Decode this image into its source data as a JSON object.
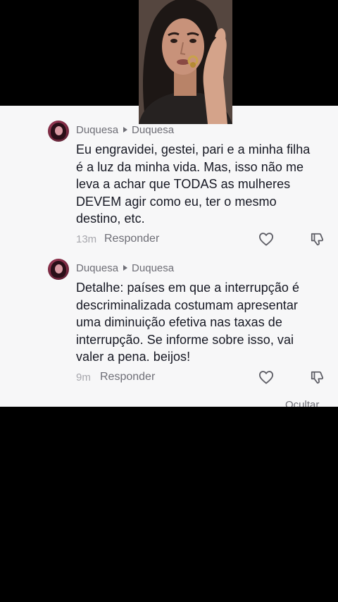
{
  "comments": [
    {
      "author": "Duquesa",
      "reply_to": "Duquesa",
      "text": "Eu engravidei, gestei, pari e a minha filha\né a luz da minha vida. Mas, isso não me\nleva a achar que TODAS as mulheres\nDEVEM agir como eu, ter o mesmo\ndestino, etc.",
      "time": "13m",
      "reply_label": "Responder"
    },
    {
      "author": "Duquesa",
      "reply_to": "Duquesa",
      "text": "Detalhe: países em que a interrupção é\ndescriminalizada costumam apresentar\numa diminuição efetiva nas taxas de\ninterrupção. Se informe sobre isso, vai\nvaler a pena. beijos!",
      "time": "9m",
      "reply_label": "Responder"
    }
  ],
  "hide_label": "Ocultar",
  "colors": {
    "panel_bg": "#f7f7f8",
    "text": "#161823",
    "muted": "#6e6e76",
    "time": "#a7a7ad"
  },
  "icons": {
    "reply_arrow": "caret-right-icon",
    "like": "heart-outline-icon",
    "dislike": "thumbs-down-outline-icon"
  }
}
